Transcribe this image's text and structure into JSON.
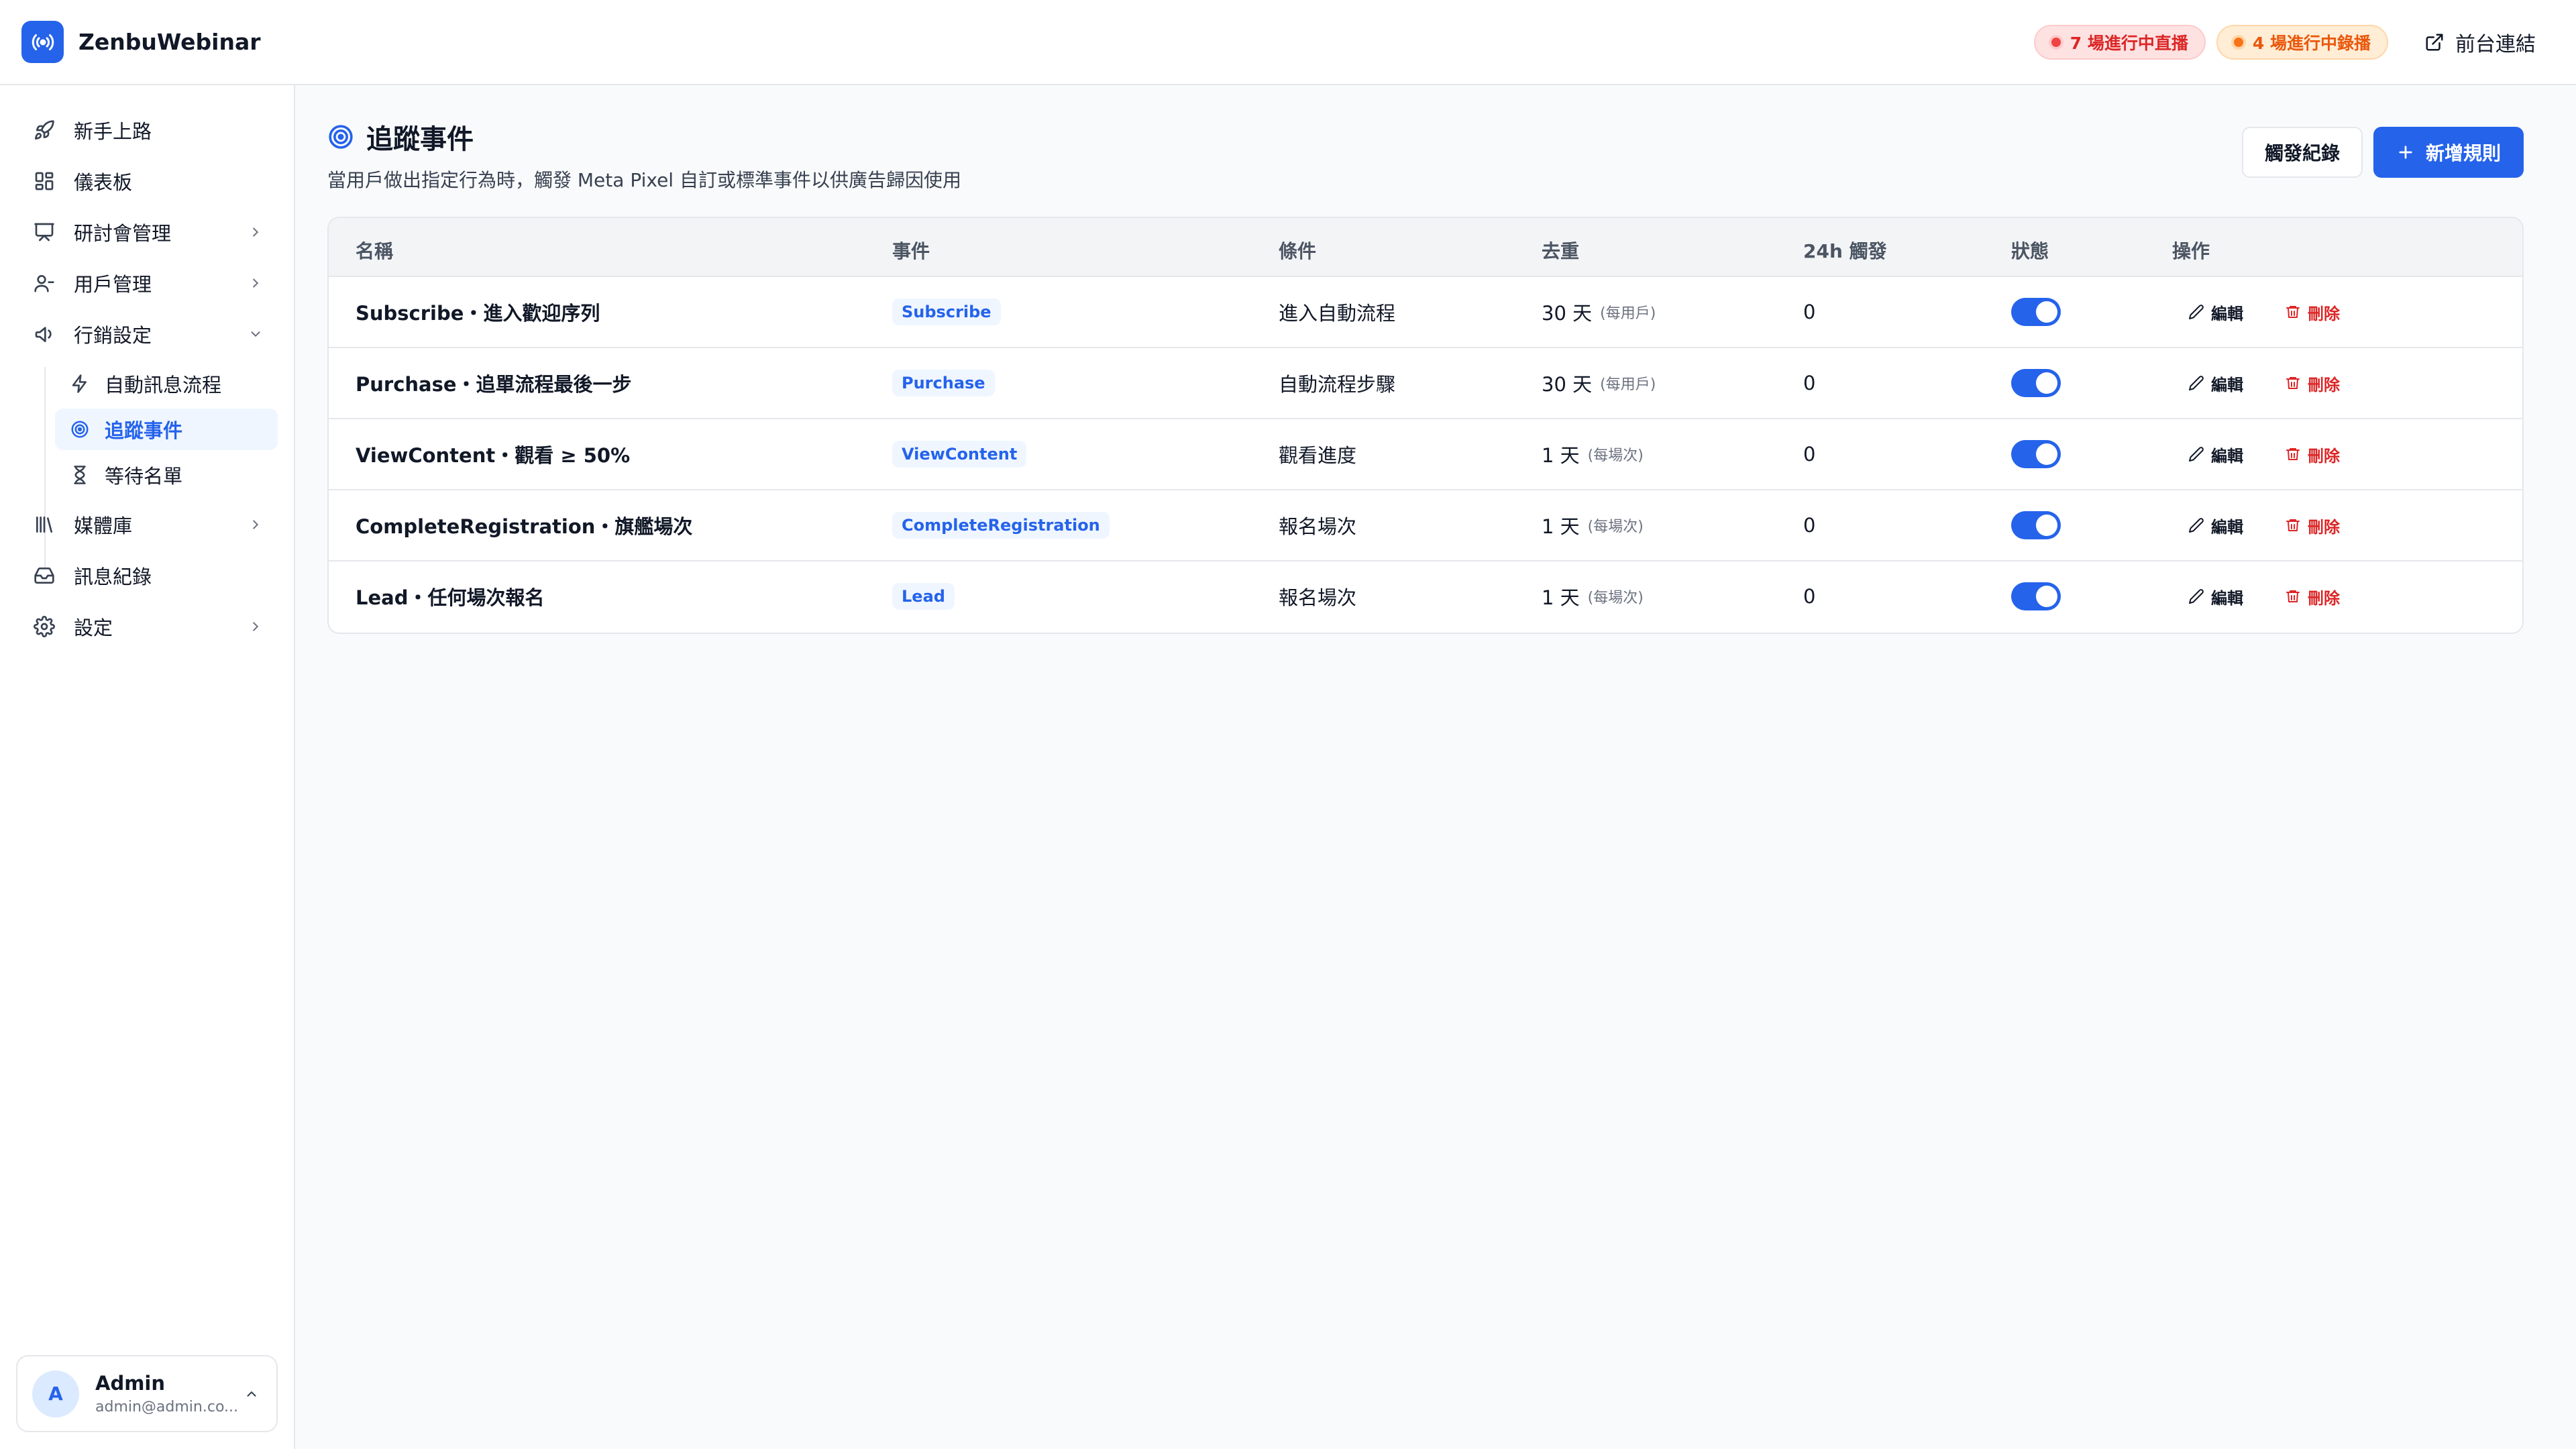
{
  "header": {
    "brand": "ZenbuWebinar",
    "live_badge": "7 場進行中直播",
    "recording_badge": "4 場進行中錄播",
    "front_link": "前台連結"
  },
  "sidebar": {
    "items": [
      {
        "label": "新手上路",
        "icon": "rocket-icon"
      },
      {
        "label": "儀表板",
        "icon": "dashboard-icon"
      },
      {
        "label": "研討會管理",
        "icon": "presentation-icon"
      },
      {
        "label": "用戶管理",
        "icon": "user-icon"
      },
      {
        "label": "行銷設定",
        "icon": "megaphone-icon"
      },
      {
        "label": "媒體庫",
        "icon": "library-icon"
      },
      {
        "label": "訊息紀錄",
        "icon": "inbox-icon"
      },
      {
        "label": "設定",
        "icon": "gear-icon"
      }
    ],
    "sub_items": [
      {
        "label": "自動訊息流程",
        "icon": "lightning-icon"
      },
      {
        "label": "追蹤事件",
        "icon": "target-icon"
      },
      {
        "label": "等待名單",
        "icon": "hourglass-icon"
      }
    ],
    "user": {
      "initial": "A",
      "name": "Admin",
      "email": "admin@admin.co..."
    }
  },
  "page": {
    "title": "追蹤事件",
    "subtitle": "當用戶做出指定行為時，觸發 Meta Pixel 自訂或標準事件以供廣告歸因使用",
    "history_button": "觸發紀錄",
    "add_button": "新增規則"
  },
  "table": {
    "headers": [
      "名稱",
      "事件",
      "條件",
      "去重",
      "24h 觸發",
      "狀態",
      "操作"
    ],
    "edit_label": "編輯",
    "delete_label": "刪除",
    "rows": [
      {
        "name": "Subscribe・進入歡迎序列",
        "event": "Subscribe",
        "condition": "進入自動流程",
        "dedup": "30 天",
        "dedup_unit": "(每用戶)",
        "count": "0",
        "enabled": true
      },
      {
        "name": "Purchase・追單流程最後一步",
        "event": "Purchase",
        "condition": "自動流程步驟",
        "dedup": "30 天",
        "dedup_unit": "(每用戶)",
        "count": "0",
        "enabled": true
      },
      {
        "name": "ViewContent・觀看 ≥ 50%",
        "event": "ViewContent",
        "condition": "觀看進度",
        "dedup": "1 天",
        "dedup_unit": "(每場次)",
        "count": "0",
        "enabled": true
      },
      {
        "name": "CompleteRegistration・旗艦場次",
        "event": "CompleteRegistration",
        "condition": "報名場次",
        "dedup": "1 天",
        "dedup_unit": "(每場次)",
        "count": "0",
        "enabled": true
      },
      {
        "name": "Lead・任何場次報名",
        "event": "Lead",
        "condition": "報名場次",
        "dedup": "1 天",
        "dedup_unit": "(每場次)",
        "count": "0",
        "enabled": true
      }
    ]
  },
  "colors": {
    "accent": "#2563eb",
    "danger": "#dc2626",
    "warning": "#ea580c"
  }
}
